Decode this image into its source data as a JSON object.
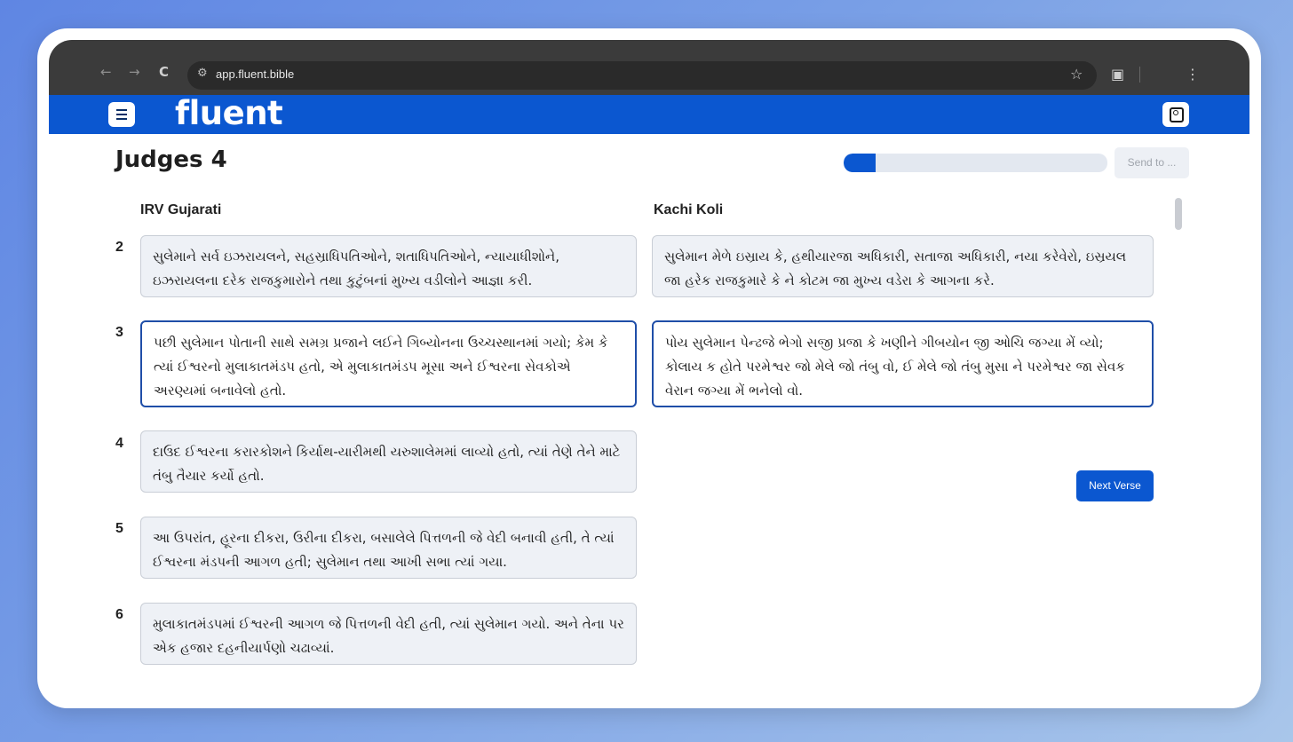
{
  "browser": {
    "url": "app.fluent.bible",
    "back_icon": "←",
    "forward_icon": "→",
    "reload_icon": "C",
    "site_info_icon": "⚙",
    "bookmark_icon": "☆",
    "sidepanel_icon": "▣",
    "menu_icon": "⋮"
  },
  "app": {
    "logo": "fluent",
    "brand_color": "#0b57d0"
  },
  "page": {
    "title": "Judges 4",
    "progress": 0.12,
    "send_label": "Send to ..."
  },
  "columns": {
    "source": "IRV Gujarati",
    "target": "Kachi Koli"
  },
  "verses": [
    {
      "number": "2",
      "source": "સુલેમાને સર્વ ઇઝરાયલને, સહસ્રાધિપતિઓને, શતાધિપતિઓને, ન્યાયાધીશોને, ઇઝરાયલના દરેક રાજકુમારોને તથા કુટુંબનાં મુખ્ય વડીલોને આજ્ઞા કરી.",
      "target": "સુલેમાન મેળે ઇસ્રાય કે, હથીયારજા અધિકારી, સતાજા અધિકારી, નયા કરેવેરો, ઇસ્રયલ જા હરેક રાજકુમારે કે ને કોટમ જા મુખ્ય વડેરા કે આગના કરે."
    },
    {
      "number": "3",
      "source": "પછી સુલેમાન પોતાની સાથે સમગ્ર પ્રજાને લઈને ગિબ્યોનના ઉચ્ચસ્થાનમાં ગયો; કેમ કે ત્યાં ઈશ્વરનો મુલાકાતમંડપ હતો, એ મુલાકાતમંડપ મૂસા અને ઈશ્વરના સેવકોએ અરણ્યમાં બનાવેલો હતો.",
      "target": "પોય સુલેમાન પેન્ઢજે ભેગો સજી પ્રજા કે ખણીને ગીબયોન જી ઓચિ જગ્યા મેં વ્યો; કોલાય ક હોતે પરમેશ્વર જો મેલે જો તંબુ વો, ઈ મેલે જો તંબુ મુસા ને પરમેશ્વર જા સેવક વેરાન જગ્યા મેં ભનેલો વો."
    },
    {
      "number": "4",
      "source": "દાઉદ ઈશ્વરના કરારકોશને કિર્યાથ-યારીમથી યરુશાલેમમાં લાવ્યો હતો, ત્યાં તેણે તેને માટે તંબુ તૈયાર કર્યો હતો."
    },
    {
      "number": "5",
      "source": "આ ઉપરાંત, હૂરના દીકરા, ઉરીના દીકરા, બસાલેલે પિત્તળની જે વેદી બનાવી હતી, તે ત્યાં ઈશ્વરના મંડપની આગળ હતી; સુલેમાન તથા આખી સભા ત્યાં ગયા."
    },
    {
      "number": "6",
      "source": "મુલાકાતમંડપમાં ઈશ્વરની આગળ જે પિત્તળની વેદી હતી, ત્યાં સુલેમાન ગયો. અને તેના પર એક હજાર દહનીયાર્પણો ચઢાવ્યાં."
    }
  ],
  "next_label": "Next Verse"
}
